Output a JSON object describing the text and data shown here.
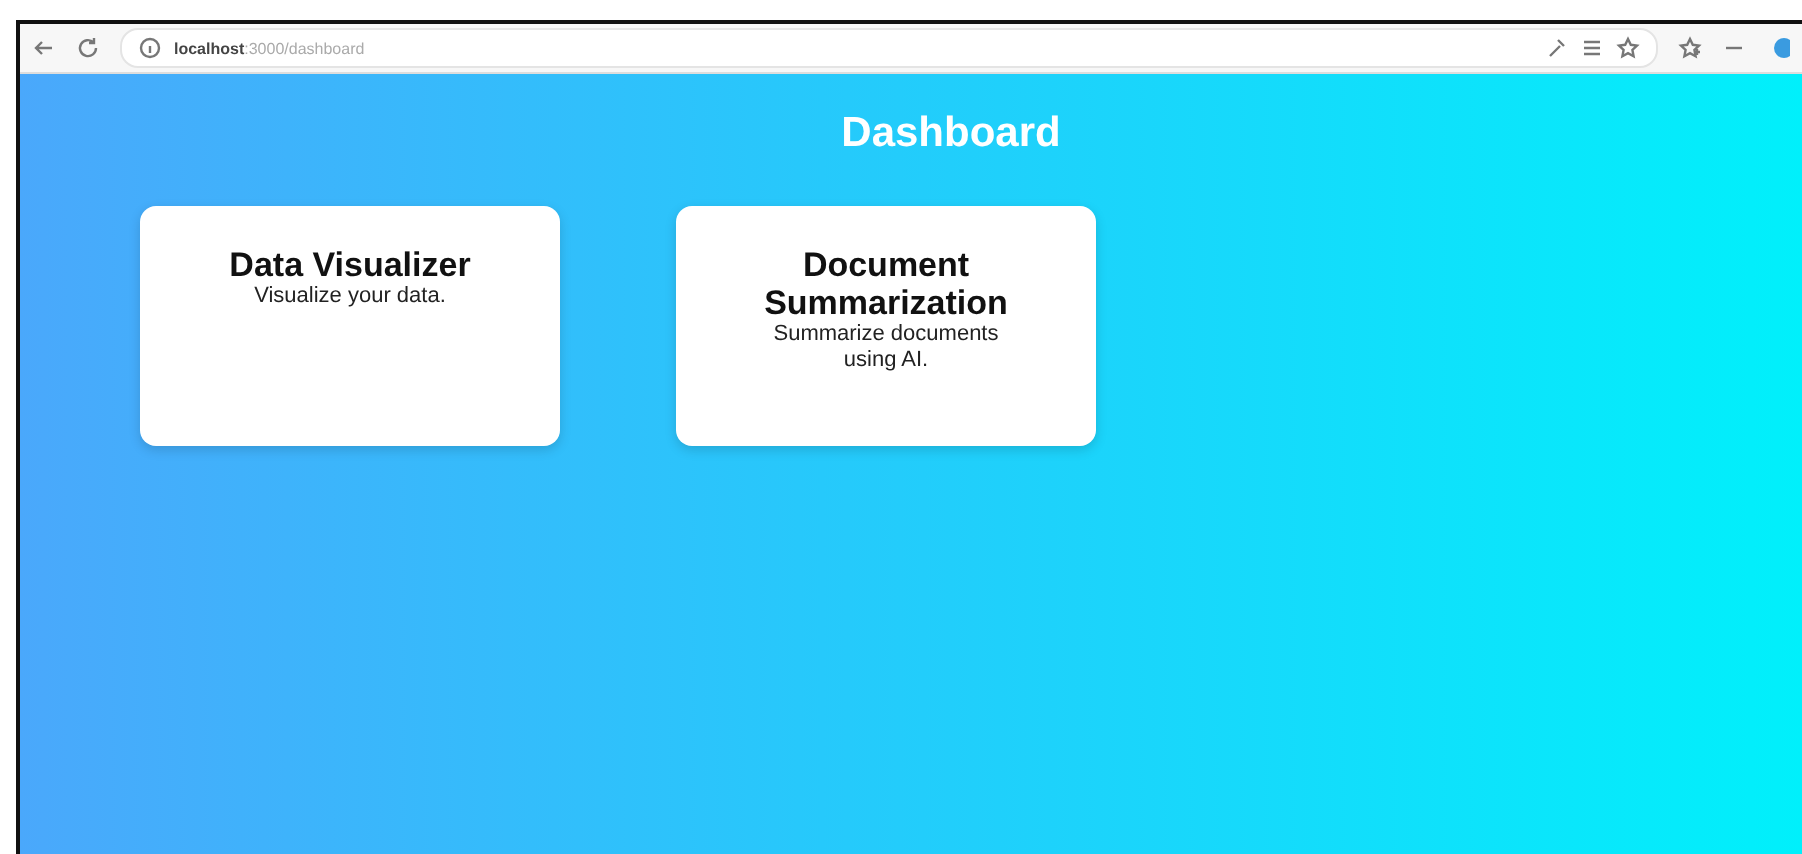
{
  "browser": {
    "url_host": "localhost",
    "url_path": ":3000/dashboard"
  },
  "page": {
    "title": "Dashboard"
  },
  "cards": [
    {
      "title": "Data Visualizer",
      "description": "Visualize your data."
    },
    {
      "title": "Document Summarization",
      "description": "Summarize documents using AI."
    }
  ]
}
